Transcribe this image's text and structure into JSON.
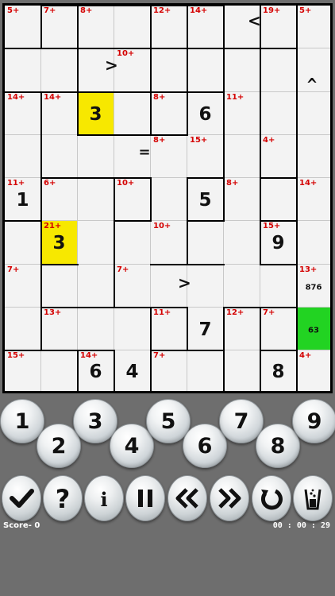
{
  "board": {
    "rows": [
      [
        {
          "clue": "5+"
        },
        {
          "clue": "7+"
        },
        {
          "clue": "8+"
        },
        {},
        {
          "clue": "12+"
        },
        {
          "clue": "14+"
        },
        {},
        {
          "clue": "19+"
        },
        {
          "clue": "5+"
        }
      ],
      [
        {},
        {},
        {},
        {
          "clue": "10+"
        },
        {},
        {},
        {},
        {},
        {}
      ],
      [
        {
          "clue": "14+"
        },
        {
          "clue": "14+"
        },
        {
          "value": "3",
          "highlight": "yellow"
        },
        {},
        {
          "clue": "8+"
        },
        {
          "value": "6"
        },
        {
          "clue": "11+"
        },
        {},
        {}
      ],
      [
        {},
        {},
        {},
        {},
        {
          "clue": "8+"
        },
        {
          "clue": "15+"
        },
        {},
        {
          "clue": "4+"
        },
        {}
      ],
      [
        {
          "clue": "11+",
          "value": "1"
        },
        {
          "clue": "6+"
        },
        {},
        {
          "clue": "10+"
        },
        {},
        {
          "value": "5"
        },
        {
          "clue": "8+"
        },
        {},
        {
          "clue": "14+"
        }
      ],
      [
        {},
        {
          "clue": "21+",
          "value": "3",
          "highlight": "yellow"
        },
        {},
        {},
        {
          "clue": "10+"
        },
        {},
        {},
        {
          "clue": "15+",
          "value": "9"
        },
        {}
      ],
      [
        {
          "clue": "7+"
        },
        {},
        {},
        {
          "clue": "7+"
        },
        {},
        {},
        {},
        {},
        {
          "clue": "13+",
          "notes": "876"
        }
      ],
      [
        {},
        {
          "clue": "13+"
        },
        {},
        {},
        {
          "clue": "11+"
        },
        {
          "value": "7"
        },
        {
          "clue": "12+"
        },
        {
          "clue": "7+"
        },
        {
          "notes": "63",
          "highlight": "green"
        }
      ],
      [
        {
          "clue": "15+"
        },
        {},
        {
          "clue": "14+",
          "value": "6"
        },
        {
          "value": "4"
        },
        {
          "clue": "7+"
        },
        {},
        {},
        {
          "value": "8"
        },
        {
          "clue": "4+"
        }
      ]
    ],
    "operators": [
      {
        "row": 0,
        "col": 6,
        "symbol": "<"
      },
      {
        "row": 1,
        "col": 2,
        "symbol": ">"
      },
      {
        "row": 1,
        "col": 8,
        "symbol": "^"
      },
      {
        "row": 3,
        "col": 3,
        "symbol": "="
      },
      {
        "row": 6,
        "col": 4,
        "symbol": ">"
      }
    ]
  },
  "keypad": [
    "1",
    "2",
    "3",
    "4",
    "5",
    "6",
    "7",
    "8",
    "9"
  ],
  "toolbar": [
    {
      "name": "check-button",
      "icon": "checkmark-icon"
    },
    {
      "name": "hint-button",
      "icon": "question-icon"
    },
    {
      "name": "info-button",
      "icon": "info-icon"
    },
    {
      "name": "pause-button",
      "icon": "pause-icon"
    },
    {
      "name": "undo-button",
      "icon": "double-left-icon"
    },
    {
      "name": "redo-button",
      "icon": "double-right-icon"
    },
    {
      "name": "restart-button",
      "icon": "restart-icon"
    },
    {
      "name": "erase-button",
      "icon": "trash-icon"
    }
  ],
  "status": {
    "score_label": "Score-",
    "score": "0",
    "timer": "00 : 00 : 29"
  },
  "colors": {
    "clue": "#d40000",
    "highlight_yellow": "#f7e800",
    "highlight_green": "#22d322",
    "background": "#6e6e6e"
  }
}
